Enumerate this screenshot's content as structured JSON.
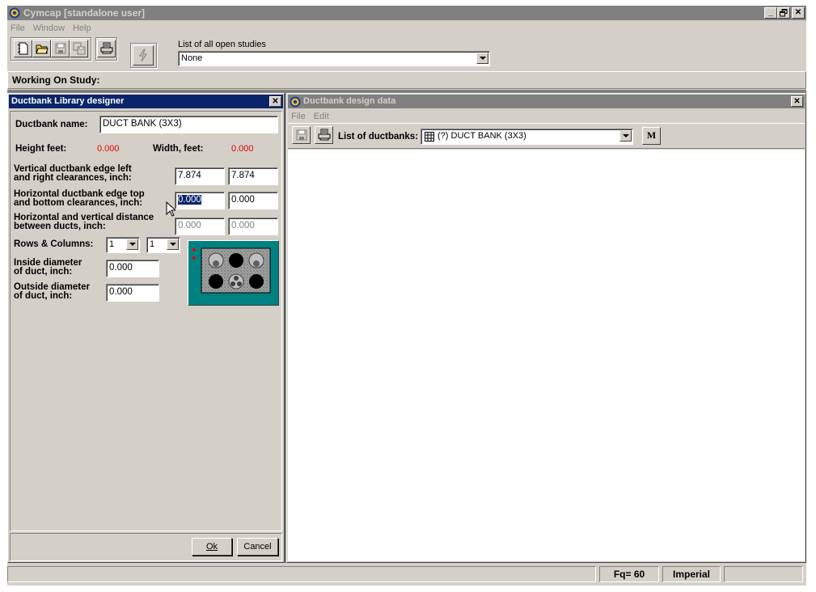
{
  "app": {
    "title": "Cymcap [standalone user]",
    "menu": [
      "File",
      "Window",
      "Help"
    ],
    "caption_buttons": [
      "_",
      " ",
      "X"
    ]
  },
  "toolbar": {
    "studies_label": "List of all open studies",
    "studies_value": "None"
  },
  "study_bar": {
    "label": "Working On Study:"
  },
  "designer": {
    "title": "Ductbank Library designer",
    "name_label": "Ductbank name:",
    "name_value": "DUCT BANK (3X3)",
    "height_label": "Height feet:",
    "height_value": "0.000",
    "width_label": "Width, feet:",
    "width_value": "0.000",
    "vertical_label_1": "Vertical ductbank edge left",
    "vertical_label_2": "and right clearances, inch:",
    "vertical_left": "7.874",
    "vertical_right": "7.874",
    "horizontal_label_1": "Horizontal ductbank edge top",
    "horizontal_label_2": "and bottom clearances, inch:",
    "horizontal_top": "0.000",
    "horizontal_bottom": "0.000",
    "distance_label_1": "Horizontal and vertical distance",
    "distance_label_2": "between ducts, inch:",
    "distance_h": "0.000",
    "distance_v": "0.000",
    "rows_cols_label": "Rows & Columns:",
    "rows_value": "1",
    "cols_value": "1",
    "inside_label_1": "Inside diameter",
    "inside_label_2": "of duct, inch:",
    "inside_value": "0.000",
    "outside_label_1": "Outside diameter",
    "outside_label_2": "of duct, inch:",
    "outside_value": "0.000",
    "ok_label": "Ok",
    "cancel_label": "Cancel"
  },
  "design_data": {
    "title": "Ductbank design data",
    "menu": [
      "File",
      "Edit"
    ],
    "list_label": "List of ductbanks:",
    "list_value": "(?) DUCT BANK (3X3)",
    "m_button": "M"
  },
  "status": {
    "frequency": "Fq= 60",
    "units": "Imperial"
  },
  "colors": {
    "active_title": "#0a246a",
    "inactive_title": "#808080",
    "face": "#d4d0c8",
    "preview_bg": "#008080",
    "dimension_value": "#e00000"
  }
}
